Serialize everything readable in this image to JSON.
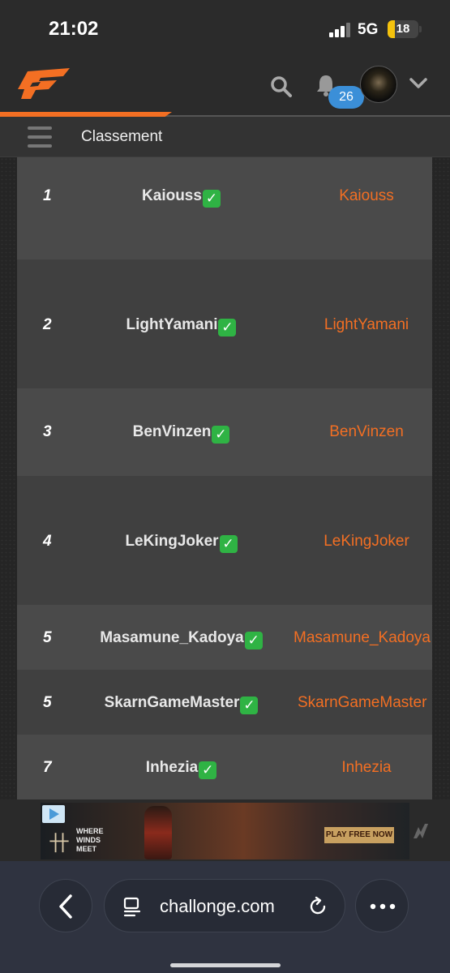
{
  "status_bar": {
    "time": "21:02",
    "network": "5G",
    "battery": "18",
    "battery_level": 0.18,
    "signal_bars": 3,
    "signal_bars_max": 4
  },
  "header": {
    "accent_color": "#f36f23",
    "notification_count": "26",
    "search_icon": "search-icon",
    "bell_icon": "bell-icon",
    "chevron_icon": "chevron-down-icon"
  },
  "subheader": {
    "title": "Classement",
    "menu_icon": "hamburger-icon"
  },
  "standings": [
    {
      "rank": "1",
      "name": "Kaiouss",
      "link": "Kaiouss",
      "verified": true
    },
    {
      "rank": "2",
      "name": "LightYamani",
      "link": "LightYamani",
      "verified": true
    },
    {
      "rank": "3",
      "name": "BenVinzen",
      "link": "BenVinzen",
      "verified": true
    },
    {
      "rank": "4",
      "name": "LeKingJoker",
      "link": "LeKingJoker",
      "verified": true
    },
    {
      "rank": "5",
      "name": "Masamune_Kadoya",
      "link": "Masamune_Kadoya",
      "verified": true
    },
    {
      "rank": "5",
      "name": "SkarnGameMaster",
      "link": "SkarnGameMaster",
      "verified": true
    },
    {
      "rank": "7",
      "name": "Inhezia",
      "link": "Inhezia",
      "verified": true
    }
  ],
  "ad": {
    "headline": "WHERE WINDS MEET",
    "cta": "PLAY FREE NOW"
  },
  "browser": {
    "url": "challonge.com",
    "back_icon": "back-arrow-icon",
    "reader_icon": "reader-mode-icon",
    "reload_icon": "reload-icon",
    "more_icon": "more-options-icon"
  }
}
